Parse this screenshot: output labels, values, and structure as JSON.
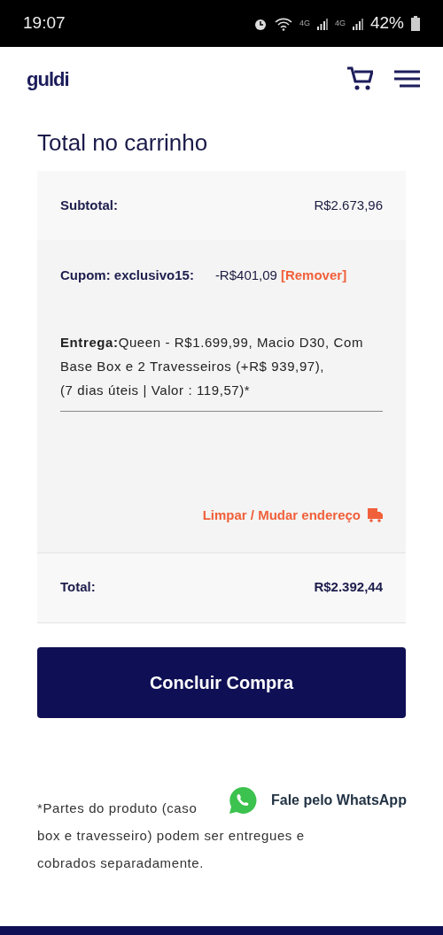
{
  "status_bar": {
    "time": "19:07",
    "network_labels": [
      "4G",
      "4G"
    ],
    "battery": "42%"
  },
  "header": {
    "logo": "guldi"
  },
  "title": "Total no carrinho",
  "subtotal": {
    "label": "Subtotal:",
    "value": "R$2.673,96"
  },
  "coupon": {
    "label": "Cupom: exclusivo15:",
    "value": "-R$401,09",
    "remove_link": "[Remover]"
  },
  "delivery": {
    "lines": [
      "**Entrega:**Queen - R$1.699,99, Macio D30, Com Base Box e 2 Travesseiros (+R$ 939,97),",
      "(7 dias úteis | Valor : 119,57)*"
    ],
    "address_link": "Limpar / Mudar endereço"
  },
  "total": {
    "label": "Total:",
    "value": "R$2.392,44"
  },
  "checkout_button": "Concluir Compra",
  "footnote_lines": [
    "*Partes do produto (caso",
    "box e travesseiro) podem ser entregues e",
    "cobrados separadamente."
  ],
  "whatsapp": {
    "label": "Fale pelo WhatsApp"
  }
}
